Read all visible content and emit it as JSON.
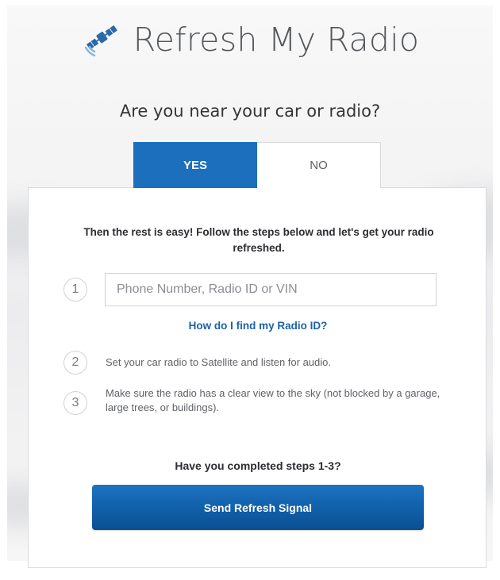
{
  "header": {
    "brand": "Refresh My Radio",
    "logo_icon": "satellite-icon"
  },
  "question": "Are you near your car or radio?",
  "toggle": {
    "yes_label": "YES",
    "no_label": "NO",
    "selected": "YES"
  },
  "card": {
    "intro": "Then the rest is easy! Follow the steps below and let's get your radio refreshed.",
    "steps": [
      {
        "number": "1",
        "placeholder": "Phone Number, Radio ID or VIN",
        "value": ""
      },
      {
        "number": "2",
        "text": "Set your car radio to Satellite and listen for audio."
      },
      {
        "number": "3",
        "text": "Make sure the radio has a clear view to the sky (not blocked by a garage, large trees, or buildings)."
      }
    ],
    "help_link": "How do I find my Radio ID?",
    "completed_question": "Have you completed steps 1-3?",
    "send_button": "Send Refresh Signal"
  },
  "colors": {
    "accent": "#1b6fbd",
    "link": "#1c62a7",
    "button_dark": "#0b4f92",
    "icon_dark": "#2b6aa8",
    "icon_light": "#8bb6de"
  }
}
